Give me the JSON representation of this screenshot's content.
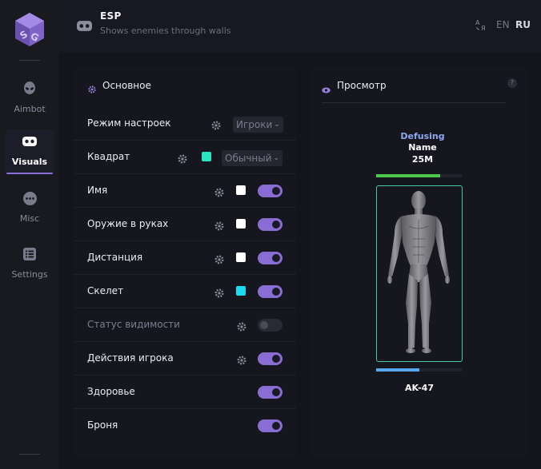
{
  "sidebar": {
    "items": [
      {
        "label": "Aimbot",
        "icon": "alien-icon"
      },
      {
        "label": "Visuals",
        "icon": "mask-icon",
        "active": true
      },
      {
        "label": "Misc",
        "icon": "dots-icon"
      },
      {
        "label": "Settings",
        "icon": "list-icon"
      }
    ]
  },
  "header": {
    "title": "ESP",
    "subtitle": "Shows enemies through walls",
    "lang_en": "EN",
    "lang_ru": "RU",
    "active_lang": "RU"
  },
  "main_panel": {
    "title": "Основное",
    "rows": [
      {
        "label": "Режим настроек",
        "select": "Игроки"
      },
      {
        "label": "Квадрат",
        "select": "Обычный",
        "color": "#2ae6c0"
      },
      {
        "label": "Имя",
        "color": "#ffffff",
        "toggle": true
      },
      {
        "label": "Оружие в руках",
        "color": "#ffffff",
        "toggle": true
      },
      {
        "label": "Дистанция",
        "color": "#ffffff",
        "toggle": true
      },
      {
        "label": "Скелет",
        "color": "#1ad9f0",
        "toggle": true
      },
      {
        "label": "Статус видимости",
        "toggle": false,
        "disabled": true
      },
      {
        "label": "Действия игрока",
        "toggle": true
      },
      {
        "label": "Здоровье",
        "toggle": true
      },
      {
        "label": "Броня",
        "toggle": true
      }
    ]
  },
  "preview_panel": {
    "title": "Просмотр",
    "help": "?",
    "status": "Defusing",
    "name": "Name",
    "distance": "25M",
    "health_fraction": 0.75,
    "armor_fraction": 0.5,
    "weapon": "AK-47"
  },
  "colors": {
    "accent": "#8a6dd4",
    "box": "#3fcf9e",
    "health": "#4ec94e",
    "armor": "#58a8f0",
    "status": "#8fa8f0"
  }
}
